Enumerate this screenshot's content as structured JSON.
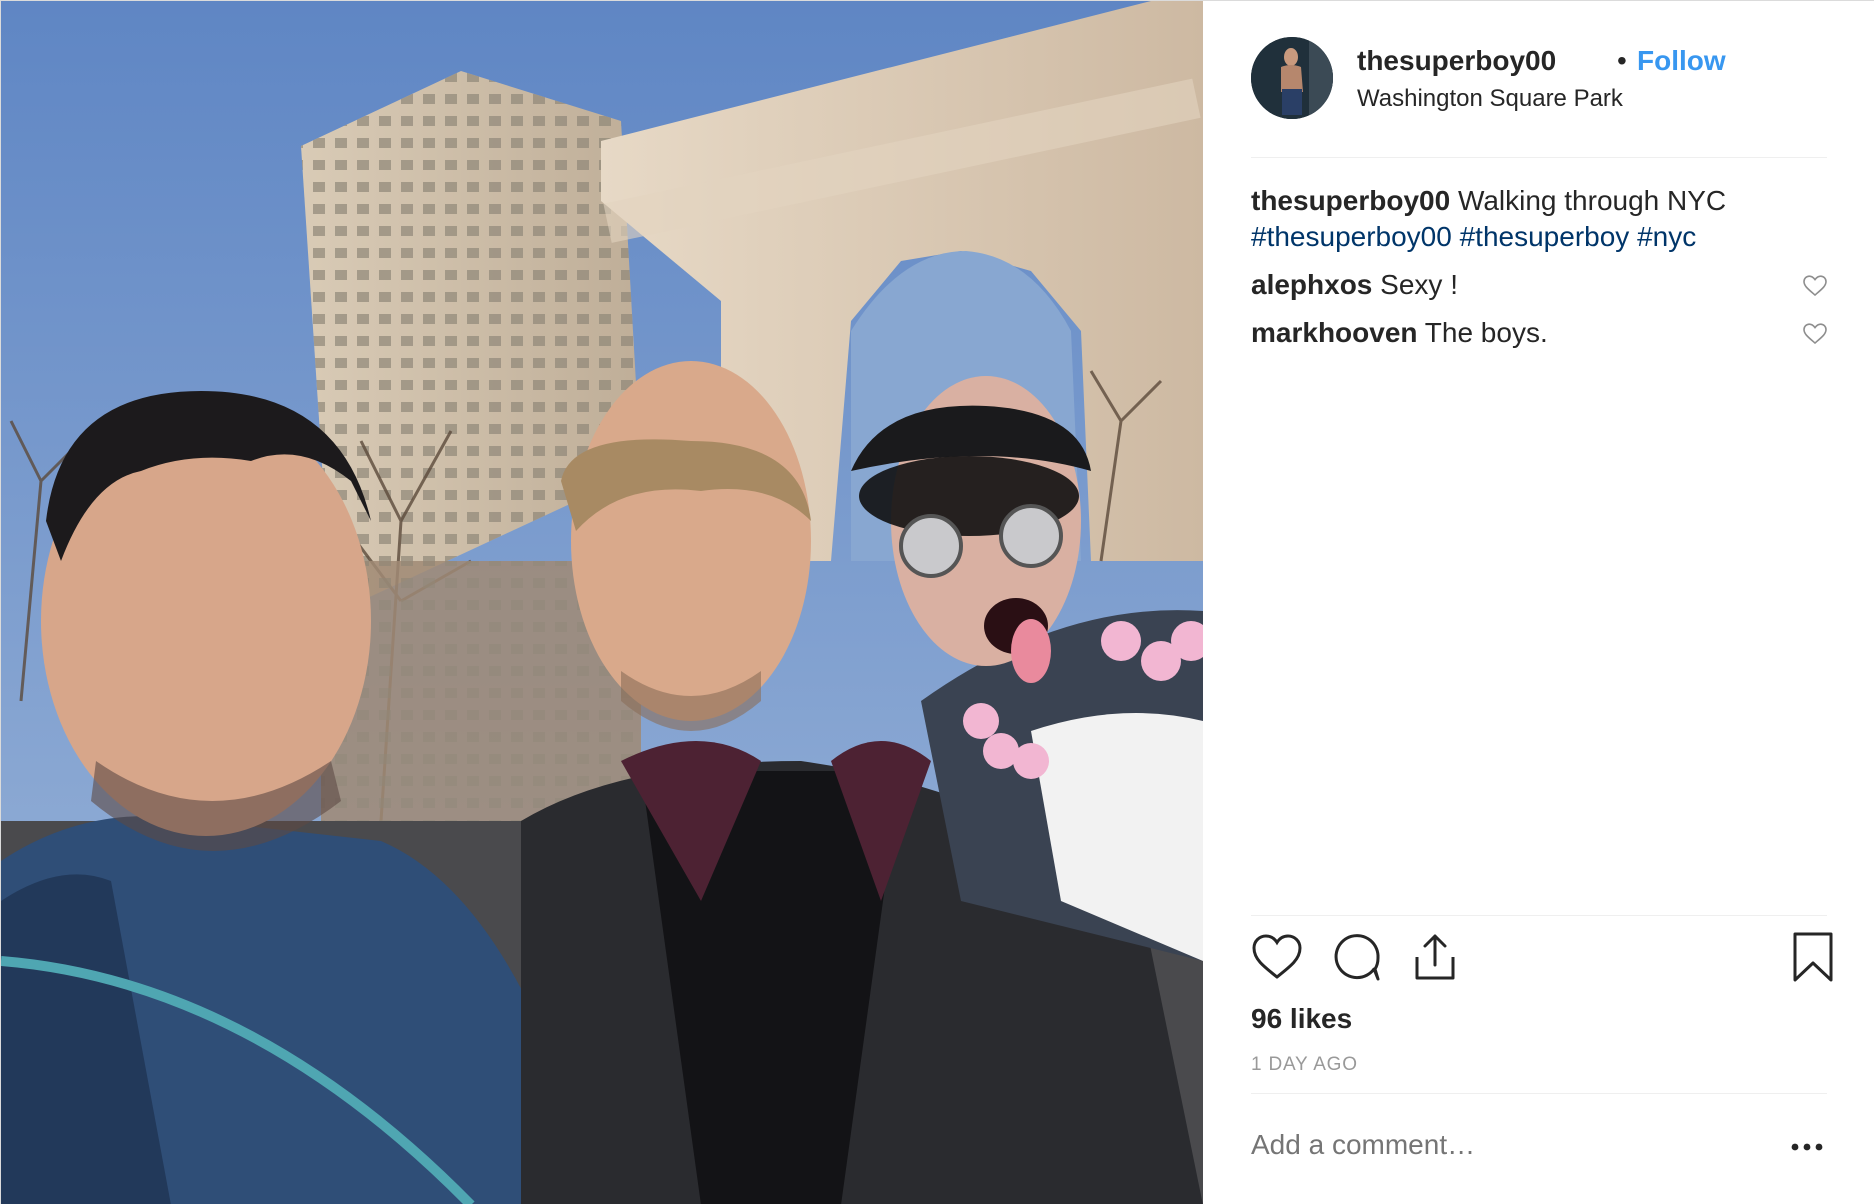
{
  "post": {
    "username": "thesuperboy00",
    "separator": "•",
    "follow_label": "Follow",
    "location": "Washington Square Park",
    "caption": {
      "username": "thesuperboy00",
      "text": "Walking through NYC",
      "hashtags": [
        "#thesuperboy00",
        "#thesuperboy",
        "#nyc"
      ]
    },
    "comments": [
      {
        "username": "alephxos",
        "text": "Sexy !"
      },
      {
        "username": "markhooven",
        "text": "The boys."
      }
    ],
    "likes": "96 likes",
    "timestamp": "1 DAY AGO",
    "add_comment_placeholder": "Add a comment…"
  },
  "colors": {
    "link_blue": "#3897f0",
    "hashtag": "#003569",
    "muted": "#999999",
    "text": "#262626",
    "divider": "#efefef"
  },
  "icons": {
    "like": "heart-icon",
    "comment": "comment-bubble-icon",
    "share": "share-icon",
    "save": "bookmark-icon",
    "more": "more-options-icon",
    "comment_like": "small-heart-icon"
  }
}
